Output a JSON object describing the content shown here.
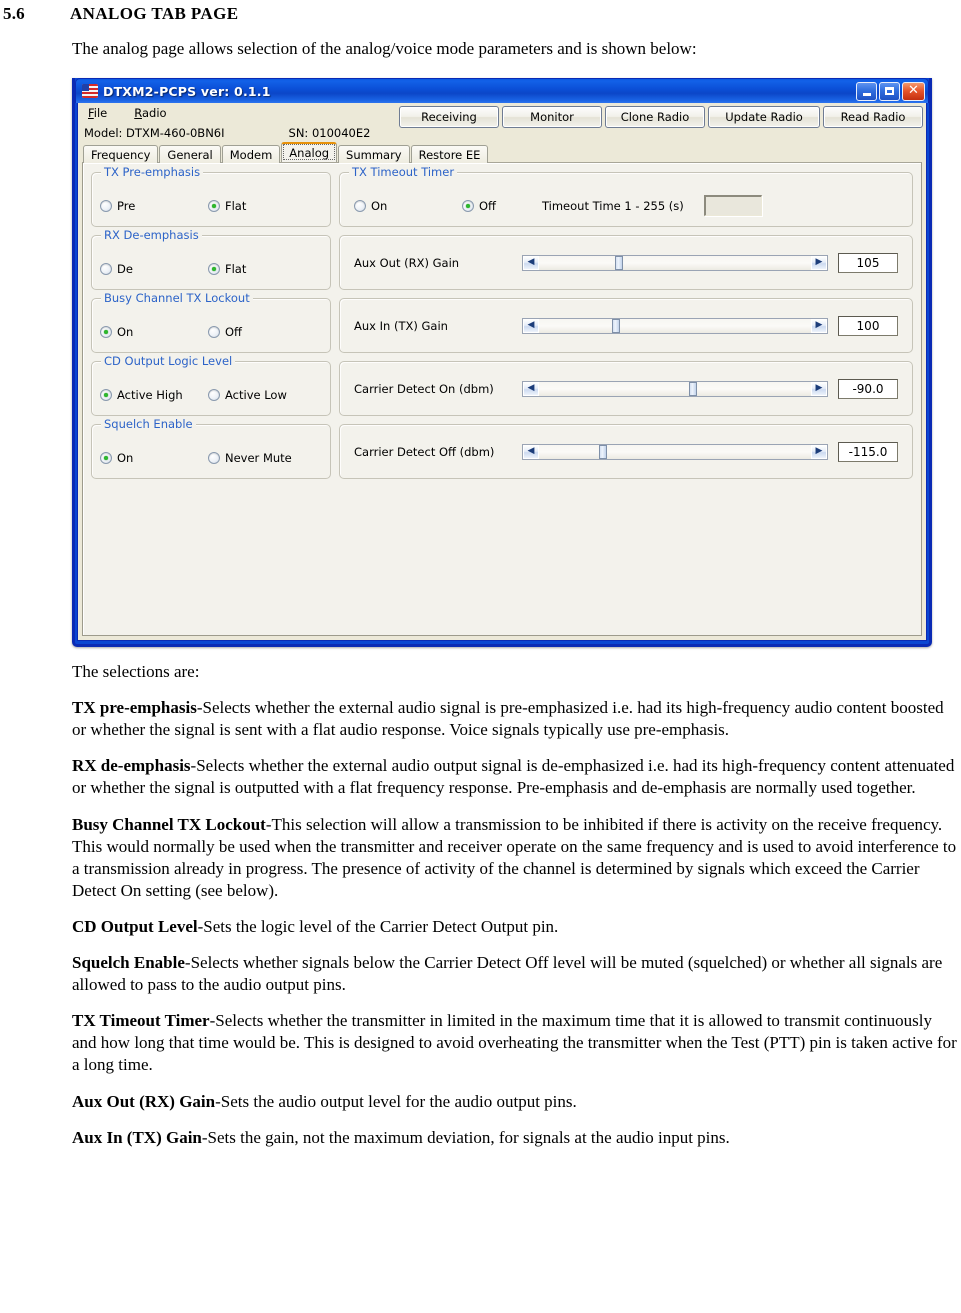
{
  "document": {
    "section_number": "5.6",
    "section_title": "ANALOG TAB PAGE",
    "intro": "The analog page allows selection of the analog/voice mode parameters and is shown below:",
    "selections_lead": "The selections are:",
    "definitions": [
      {
        "term": "TX pre-emphasis",
        "text": "-Selects whether the external audio signal is pre-emphasized i.e. had its high-frequency audio content boosted or whether the signal is sent with a flat audio response. Voice signals typically use pre-emphasis."
      },
      {
        "term": "RX de-emphasis",
        "text": "-Selects whether the external audio output signal is de-emphasized i.e. had its high-frequency content attenuated or whether the signal is outputted with a flat frequency response. Pre-emphasis and de-emphasis are normally used together."
      },
      {
        "term": "Busy Channel TX Lockout",
        "text": "-This selection will allow a transmission to be inhibited if there is activity on the receive frequency. This would normally be used when the transmitter and receiver operate on the same frequency and is used to avoid interference to a transmission already in progress. The presence of activity of the channel is determined by signals which exceed the Carrier Detect On setting (see below)."
      },
      {
        "term": "CD Output Level",
        "text": "-Sets the logic level of the Carrier Detect Output pin."
      },
      {
        "term": "Squelch Enable",
        "text": "-Selects whether signals below the Carrier Detect Off level will be muted (squelched) or whether all signals are allowed to pass to the audio output pins."
      },
      {
        "term": "TX Timeout Timer",
        "text": "-Selects whether the transmitter in limited in the maximum time that it is allowed to transmit continuously and how long that time would be. This is designed to avoid overheating the transmitter when the Test (PTT) pin is taken active for a long time."
      },
      {
        "term": "Aux Out (RX) Gain",
        "text": "-Sets the audio output level for the audio output pins."
      },
      {
        "term": "Aux In (TX) Gain",
        "text": "-Sets the gain, not the maximum deviation, for signals at the audio input pins."
      }
    ]
  },
  "app": {
    "title": "DTXM2-PCPS ver: 0.1.1",
    "icon": "flag-icon",
    "window_buttons": {
      "minimize": "–",
      "maximize": "□",
      "close": "✕"
    },
    "menu": [
      {
        "label": "File",
        "accel": "F"
      },
      {
        "label": "Radio",
        "accel": "R"
      }
    ],
    "actions": [
      {
        "label": "Receiving"
      },
      {
        "label": "Monitor"
      },
      {
        "label": "Clone Radio"
      },
      {
        "label": "Update Radio"
      },
      {
        "label": "Read Radio"
      }
    ],
    "status": {
      "model": "Model: DTXM-460-0BN6I",
      "serial": "SN: 010040E2"
    },
    "tabs": [
      {
        "label": "Frequency",
        "active": false
      },
      {
        "label": "General",
        "active": false
      },
      {
        "label": "Modem",
        "active": false
      },
      {
        "label": "Analog",
        "active": true
      },
      {
        "label": "Summary",
        "active": false
      },
      {
        "label": "Restore EE",
        "active": false
      }
    ],
    "accent_colors": {
      "title_bar": "#0b4fd6",
      "window_border": "#0a2ab4",
      "group_label": "#2c63c8",
      "active_tab_top": "#e8920a",
      "client_background": "#ece9d8",
      "page_background": "#f3f2ec",
      "radio_selected_dot": "#2db82d"
    },
    "left_groups": [
      {
        "title": "TX Pre-emphasis",
        "options": [
          {
            "label": "Pre",
            "selected": false
          },
          {
            "label": "Flat",
            "selected": true
          }
        ]
      },
      {
        "title": "RX De-emphasis",
        "options": [
          {
            "label": "De",
            "selected": false
          },
          {
            "label": "Flat",
            "selected": true
          }
        ]
      },
      {
        "title": "Busy Channel TX Lockout",
        "options": [
          {
            "label": "On",
            "selected": true
          },
          {
            "label": "Off",
            "selected": false
          }
        ]
      },
      {
        "title": "CD Output Logic Level",
        "options": [
          {
            "label": "Active High",
            "selected": true
          },
          {
            "label": "Active Low",
            "selected": false
          }
        ]
      },
      {
        "title": "Squelch Enable",
        "options": [
          {
            "label": "On",
            "selected": true
          },
          {
            "label": "Never Mute",
            "selected": false
          }
        ]
      }
    ],
    "timeout_group": {
      "title": "TX Timeout Timer",
      "options": [
        {
          "label": "On",
          "selected": false
        },
        {
          "label": "Off",
          "selected": true
        }
      ],
      "field_label": "Timeout Time  1 - 255 (s)",
      "field_value": "",
      "field_placeholder": ""
    },
    "sliders": [
      {
        "label": "Aux Out (RX) Gain",
        "value": "105",
        "thumb_percent": 28
      },
      {
        "label": "Aux In (TX) Gain",
        "value": "100",
        "thumb_percent": 27
      },
      {
        "label": "Carrier Detect On (dbm)",
        "value": "-90.0",
        "thumb_percent": 55
      },
      {
        "label": "Carrier Detect Off (dbm)",
        "value": "-115.0",
        "thumb_percent": 22
      }
    ],
    "slider_arrows": {
      "left": "◀",
      "right": "▶"
    }
  }
}
